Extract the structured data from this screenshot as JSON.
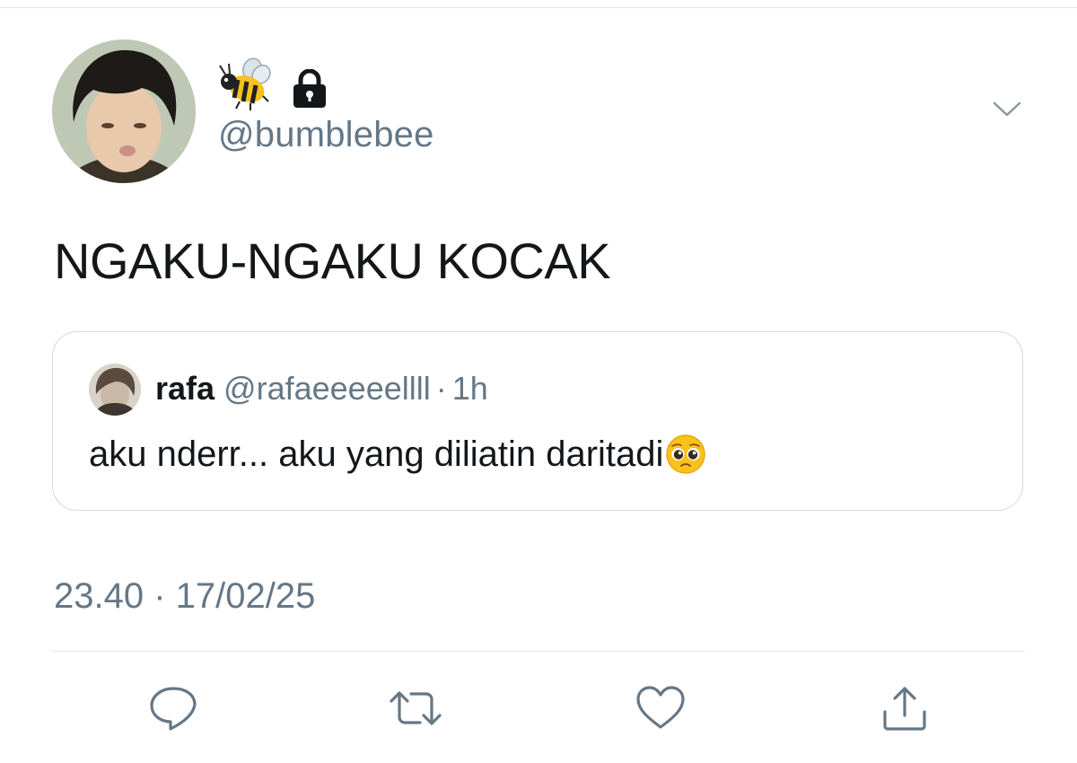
{
  "tweet": {
    "display_name_emojis": [
      "bee-emoji",
      "lock-icon"
    ],
    "handle": "@bumblebee",
    "text": "NGAKU-NGAKU KOCAK",
    "timestamp": "23.40 · 17/02/25"
  },
  "quoted_tweet": {
    "name": "rafa",
    "handle": "@rafaeeeeellll",
    "separator": "·",
    "time": "1h",
    "text": "aku nderr... aku yang diliatin daritadi",
    "trailing_emoji": "pleading-face-emoji"
  },
  "actions": [
    "reply-icon",
    "retweet-icon",
    "like-icon",
    "share-icon"
  ],
  "colors": {
    "secondary_text": "#657786",
    "primary_text": "#14171a",
    "border": "#cfd9de",
    "divider": "#e1e8ed"
  }
}
